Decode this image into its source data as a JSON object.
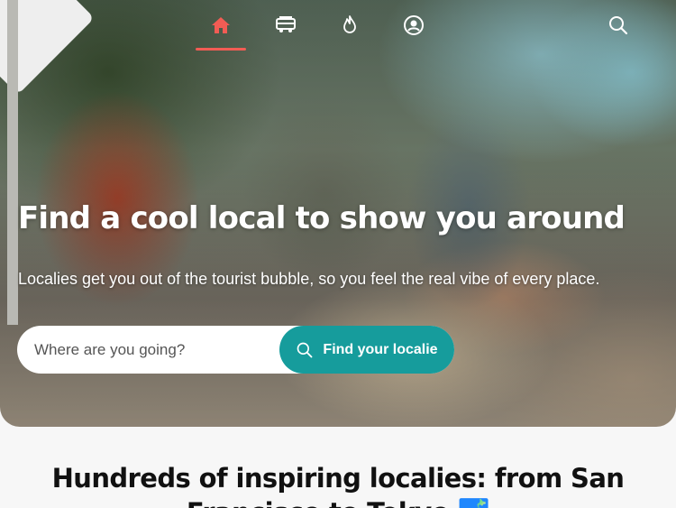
{
  "nav": {
    "items": [
      {
        "name": "home",
        "icon": "home-icon",
        "active": true
      },
      {
        "name": "bus",
        "icon": "bus-icon",
        "active": false
      },
      {
        "name": "flame",
        "icon": "flame-icon",
        "active": false
      },
      {
        "name": "profile",
        "icon": "user-circle-icon",
        "active": false
      },
      {
        "name": "search",
        "icon": "search-icon",
        "active": false
      }
    ],
    "active_color": "#f25c54"
  },
  "hero": {
    "headline": "Find a cool local to show you around",
    "subline": "Localies get you out of the tourist bubble, so you feel the real vibe of every place."
  },
  "search": {
    "placeholder": "Where are you going?",
    "value": "",
    "button_label": "Find your localie",
    "button_icon": "search-icon",
    "accent": "#169c9c"
  },
  "section": {
    "title": "Hundreds of inspiring localies: from San Francisco to Tokyo 🗾"
  }
}
